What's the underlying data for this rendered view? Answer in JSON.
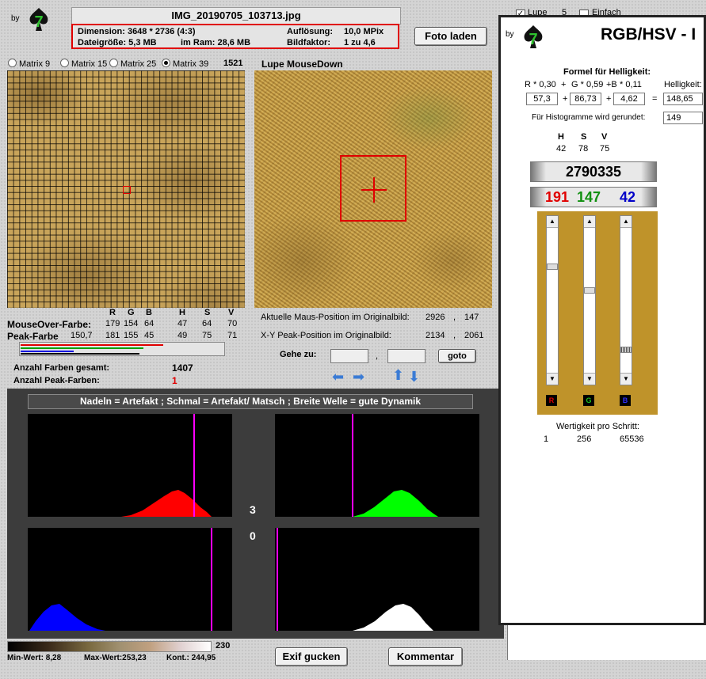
{
  "logo": {
    "by": "by",
    "number": "7"
  },
  "file": {
    "name": "IMG_20190705_103713.jpg",
    "dimension": "Dimension: 3648 * 2736 (4:3)",
    "resolution_label": "Auflösung:",
    "resolution_value": "10,0 MPix",
    "filesize": "Dateigröße: 5,3 MB",
    "ram": "im Ram: 28,6 MB",
    "factor_label": "Bildfaktor:",
    "factor_value": "1 zu 4,6"
  },
  "buttons": {
    "foto_laden": "Foto laden",
    "goto": "goto",
    "exif": "Exif gucken",
    "kommentar": "Kommentar"
  },
  "matrix": {
    "options": [
      "Matrix 9",
      "Matrix 15",
      "Matrix 25",
      "Matrix 39"
    ],
    "selected": 3,
    "count": "1521"
  },
  "lupe": {
    "title": "Lupe MouseDown"
  },
  "color_table": {
    "headers": [
      "R",
      "G",
      "B",
      "H",
      "S",
      "V"
    ],
    "mouseover_label": "MouseOver-Farbe:",
    "mouseover_values": [
      "179",
      "154",
      "64",
      "47",
      "64",
      "70"
    ],
    "peak_label": "Peak-Farbe",
    "peak_values": [
      "150,7",
      "181",
      "155",
      "45",
      "49",
      "75",
      "71"
    ]
  },
  "positions": {
    "mouse_label": "Aktuelle Maus-Position  im Originalbild:",
    "mouse_x": "2926",
    "mouse_y": "147",
    "peak_label": "X-Y Peak-Position  im Originalbild:",
    "peak_x": "2134",
    "peak_y": "2061",
    "sep": ","
  },
  "goto": {
    "label": "Gehe zu:",
    "sep": ","
  },
  "counts": {
    "total_label": "Anzahl Farben gesamt:",
    "total_value": "1407",
    "peak_label": "Anzahl Peak-Farben:",
    "peak_value": "1"
  },
  "histogram": {
    "caption": "Nadeln = Artefakt ; Schmal = Artefakt/ Matsch  ;  Breite Welle = gute Dynamik",
    "middle_top": "3",
    "middle_bottom": "0"
  },
  "gradient": {
    "max_label": "230",
    "min": "Min-Wert: 8,28",
    "max": "Max-Wert:253,23",
    "kont": "Kont.: 244,95"
  },
  "top_controls": {
    "lupe": "Lupe",
    "lupe_value": "5",
    "einfach": "Einfach"
  },
  "rgb_panel": {
    "by": "by",
    "title": "RGB/HSV - I",
    "formula_title": "Formel für Helligkeit:",
    "formula": [
      "R * 0,30",
      "+",
      "G * 0,59",
      "+B",
      "* 0,11"
    ],
    "helligkeit_label": "Helligkeit:",
    "r_val": "57,3",
    "g_val": "86,73",
    "b_val": "4,62",
    "h_val": "148,65",
    "plus": "+",
    "equals": "=",
    "rounded_label": "Für Histogramme wird gerundet:",
    "rounded_value": "149",
    "hsv_headers": [
      "H",
      "S",
      "V"
    ],
    "hsv_values": [
      "42",
      "78",
      "75"
    ],
    "color_code": "2790335",
    "rgb": [
      "191",
      "147",
      "42"
    ],
    "slider_labels": [
      "R",
      "G",
      "B"
    ],
    "wertigkeit_label": "Wertigkeit pro Schritt:",
    "wertigkeit": [
      "1",
      "256",
      "65536"
    ]
  },
  "colors": {
    "accent_red": "#e00000",
    "swatch": "#bf932a",
    "red": "#e00000",
    "green": "#109010",
    "blue": "#0000c8"
  }
}
